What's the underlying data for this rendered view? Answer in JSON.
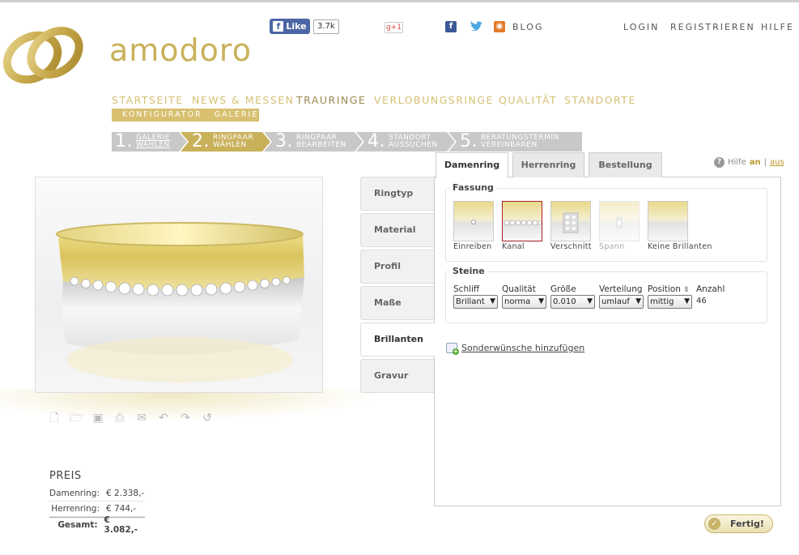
{
  "brand": {
    "name": "amodoro"
  },
  "social": {
    "like_label": "Like",
    "like_count": "3.7k",
    "gplus_label": "g+1",
    "blog_label": "BLOG"
  },
  "account": {
    "login": "LOGIN",
    "register": "REGISTRIEREN",
    "help": "HILFE"
  },
  "nav": {
    "items": [
      "STARTSEITE",
      "NEWS & MESSEN",
      "TRAURINGE",
      "VERLOBUNGSRINGE",
      "QUALITÄT",
      "STANDORTE"
    ],
    "active": "TRAURINGE",
    "sub": [
      "KONFIGURATOR",
      "GALERIE"
    ]
  },
  "steps": [
    {
      "num": "1.",
      "line1": "GALERIE",
      "line2": "WÄHLEN"
    },
    {
      "num": "2.",
      "line1": "RINGPAAR",
      "line2": "WÄHLEN"
    },
    {
      "num": "3.",
      "line1": "RINGPAAR",
      "line2": "BEARBEITEN"
    },
    {
      "num": "4.",
      "line1": "STANDORT",
      "line2": "AUSSUCHEN"
    },
    {
      "num": "5.",
      "line1": "BERATUNGSTERMIN",
      "line2": "VEREINBAREN"
    }
  ],
  "side_tabs": [
    "Ringtyp",
    "Material",
    "Profil",
    "Maße",
    "Brillanten",
    "Gravur"
  ],
  "side_tab_selected": "Brillanten",
  "panel": {
    "tabs": [
      "Damenring",
      "Herrenring",
      "Bestellung"
    ],
    "selected_tab": "Damenring",
    "help": {
      "label": "Hilfe",
      "on": "an",
      "sep": "|",
      "off": "aus"
    },
    "fassung": {
      "title": "Fassung",
      "options": [
        "Einreiben",
        "Kanal",
        "Verschnitt",
        "Spann",
        "Keine Brillanten"
      ],
      "selected": "Kanal",
      "disabled": "Spann"
    },
    "steine": {
      "title": "Steine",
      "labels": {
        "schliff": "Schliff",
        "qualitaet": "Qualität",
        "groesse": "Größe",
        "verteilung": "Verteilung",
        "position": "Position",
        "anzahl": "Anzahl"
      },
      "values": {
        "schliff": "Brillant",
        "qualitaet": "norma",
        "groesse": "0.010",
        "verteilung": "umlauf",
        "position": "mittig",
        "anzahl": "46"
      }
    },
    "sonder_label": "Sonderwünsche hinzufügen"
  },
  "price": {
    "title": "PREIS",
    "rows": [
      {
        "label": "Damenring:",
        "value": "€ 2.338,-"
      },
      {
        "label": "Herrenring:",
        "value": "€ 744,-"
      },
      {
        "label": "Gesamt:",
        "value": "€ 3.082,-"
      }
    ]
  },
  "finish_label": "Fertig!",
  "colors": {
    "gold": "#d6c074",
    "gold_dark": "#c9b15a",
    "step_active": "#c9b15a",
    "step_inactive": "#c8c8c8",
    "fb_blue": "#4c66a4"
  }
}
